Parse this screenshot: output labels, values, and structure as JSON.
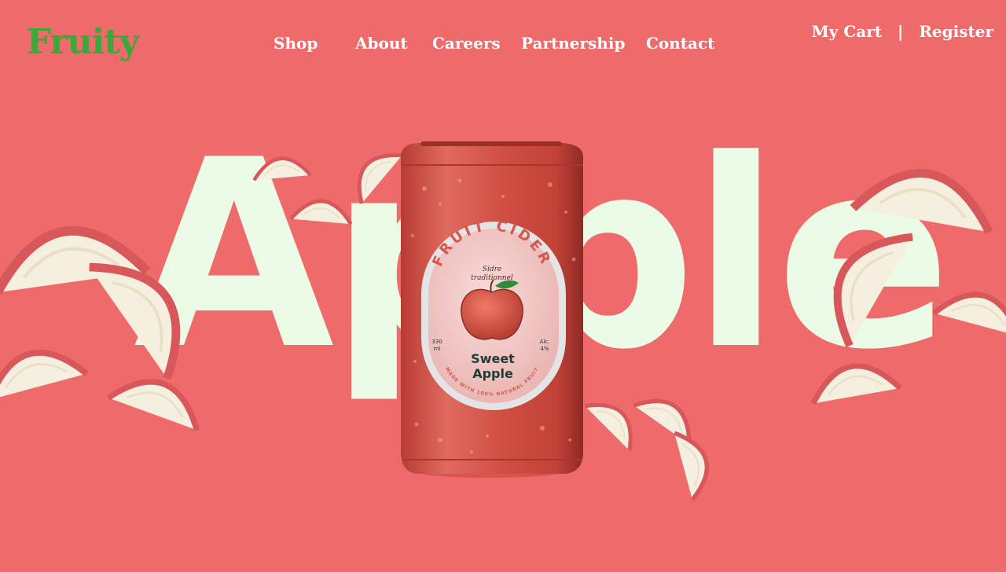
{
  "brand": {
    "name": "Fruity",
    "color": "#3da83a"
  },
  "nav": {
    "items": [
      {
        "label": "Shop"
      },
      {
        "label": "About"
      },
      {
        "label": "Careers"
      },
      {
        "label": "Partnership"
      },
      {
        "label": "Contact"
      }
    ]
  },
  "account": {
    "cart_label": "My Cart",
    "separator": "|",
    "register_label": "Register"
  },
  "hero": {
    "word": "Apple",
    "background_color": "#ef6a6a",
    "word_color": "#ecfbe6"
  },
  "product": {
    "arc_title": "FRUIT CIDER",
    "script_line_1": "Sidre",
    "script_line_2": "traditionnel",
    "volume_value": "330",
    "volume_unit": "ml",
    "alc_label": "Alc.",
    "alc_value": "4%",
    "name_line_1": "Sweet",
    "name_line_2": "Apple",
    "bottom_arc": "MADE WITH 100% NATURAL FRUIT",
    "can_color": "#d9554a",
    "label_color": "#f3c9c6"
  }
}
